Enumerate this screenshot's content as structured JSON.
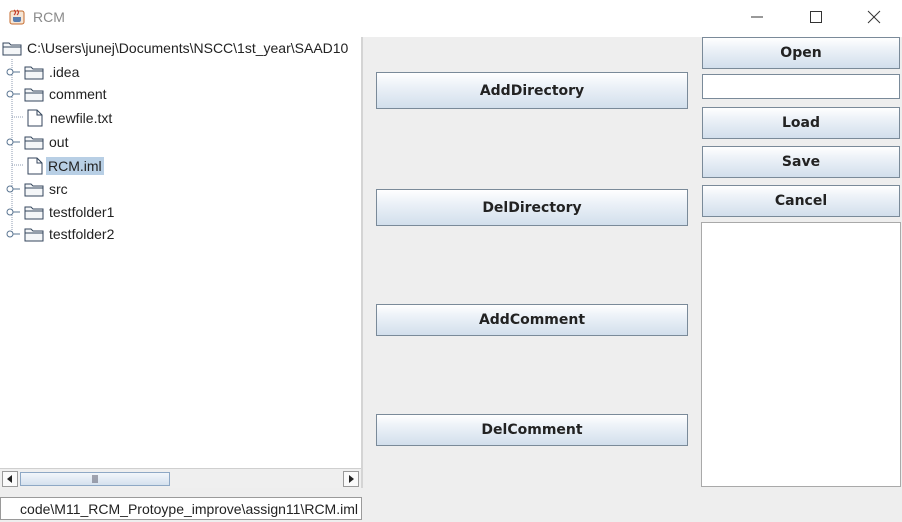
{
  "window": {
    "title": "RCM"
  },
  "tree": {
    "root": "C:\\Users\\junej\\Documents\\NSCC\\1st_year\\SAAD10",
    "items": [
      {
        "label": ".idea",
        "type": "folder",
        "expandable": true
      },
      {
        "label": "comment",
        "type": "folder",
        "expandable": true
      },
      {
        "label": "newfile.txt",
        "type": "file",
        "expandable": false
      },
      {
        "label": "out",
        "type": "folder",
        "expandable": true
      },
      {
        "label": "RCM.iml",
        "type": "file",
        "expandable": false,
        "selected": true
      },
      {
        "label": "src",
        "type": "folder",
        "expandable": true
      },
      {
        "label": "testfolder1",
        "type": "folder",
        "expandable": true
      },
      {
        "label": "testfolder2",
        "type": "folder",
        "expandable": true
      }
    ]
  },
  "actions": {
    "add_directory": "AddDirectory",
    "del_directory": "DelDirectory",
    "add_comment": "AddComment",
    "del_comment": "DelComment"
  },
  "file_ops": {
    "open": "Open",
    "input_value": "",
    "load": "Load",
    "save": "Save",
    "cancel": "Cancel"
  },
  "status": {
    "path": "code\\M11_RCM_Protoype_improve\\assign11\\RCM.iml"
  },
  "colors": {
    "selection": "#b8cfe5",
    "button_border": "#7a8a99",
    "panel_bg": "#eeeeee"
  }
}
